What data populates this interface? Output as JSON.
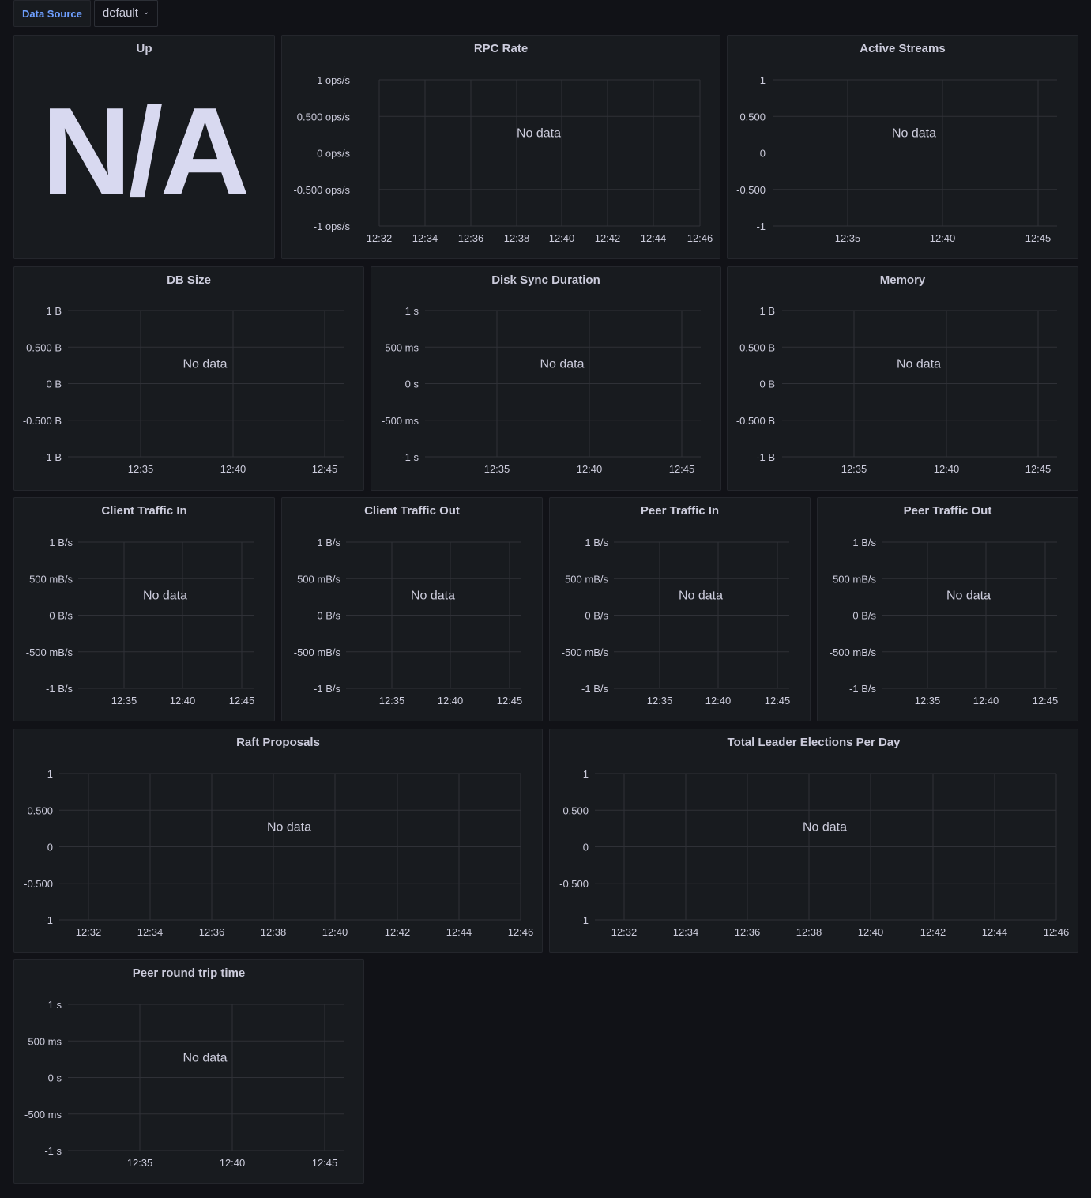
{
  "variables": {
    "label": "Data Source",
    "value": "default"
  },
  "x_ticks": {
    "five_min": [
      "12:35",
      "12:40",
      "12:45"
    ],
    "two_min": [
      "12:32",
      "12:34",
      "12:36",
      "12:38",
      "12:40",
      "12:42",
      "12:44",
      "12:46"
    ]
  },
  "y_ticks": {
    "ops": [
      "1 ops/s",
      "0.500 ops/s",
      "0 ops/s",
      "-0.500 ops/s",
      "-1 ops/s"
    ],
    "plain": [
      "1",
      "0.500",
      "0",
      "-0.500",
      "-1"
    ],
    "bytes": [
      "1 B",
      "0.500 B",
      "0 B",
      "-0.500 B",
      "-1 B"
    ],
    "seconds": [
      "1 s",
      "500 ms",
      "0 s",
      "-500 ms",
      "-1 s"
    ],
    "bps": [
      "1 B/s",
      "500 mB/s",
      "0 B/s",
      "-500 mB/s",
      "-1 B/s"
    ]
  },
  "panels": [
    {
      "id": "up",
      "type": "stat",
      "title": "Up",
      "value": "N/A"
    },
    {
      "id": "rpc-rate",
      "type": "graph",
      "title": "RPC Rate",
      "no_data": "No data",
      "y": "ops",
      "x": "two_min"
    },
    {
      "id": "active-streams",
      "type": "graph",
      "title": "Active Streams",
      "no_data": "No data",
      "y": "plain",
      "x": "five_min"
    },
    {
      "id": "db-size",
      "type": "graph",
      "title": "DB Size",
      "no_data": "No data",
      "y": "bytes",
      "x": "five_min"
    },
    {
      "id": "disk-sync-duration",
      "type": "graph",
      "title": "Disk Sync Duration",
      "no_data": "No data",
      "y": "seconds",
      "x": "five_min"
    },
    {
      "id": "memory",
      "type": "graph",
      "title": "Memory",
      "no_data": "No data",
      "y": "bytes",
      "x": "five_min"
    },
    {
      "id": "client-traffic-in",
      "type": "graph",
      "title": "Client Traffic In",
      "no_data": "No data",
      "y": "bps",
      "x": "five_min"
    },
    {
      "id": "client-traffic-out",
      "type": "graph",
      "title": "Client Traffic Out",
      "no_data": "No data",
      "y": "bps",
      "x": "five_min"
    },
    {
      "id": "peer-traffic-in",
      "type": "graph",
      "title": "Peer Traffic In",
      "no_data": "No data",
      "y": "bps",
      "x": "five_min"
    },
    {
      "id": "peer-traffic-out",
      "type": "graph",
      "title": "Peer Traffic Out",
      "no_data": "No data",
      "y": "bps",
      "x": "five_min"
    },
    {
      "id": "raft-proposals",
      "type": "graph",
      "title": "Raft Proposals",
      "no_data": "No data",
      "y": "plain",
      "x": "two_min"
    },
    {
      "id": "total-leader-elections-per-day",
      "type": "graph",
      "title": "Total Leader Elections Per Day",
      "no_data": "No data",
      "y": "plain",
      "x": "two_min"
    },
    {
      "id": "peer-round-trip-time",
      "type": "graph",
      "title": "Peer round trip time",
      "no_data": "No data",
      "y": "seconds",
      "x": "five_min"
    }
  ]
}
